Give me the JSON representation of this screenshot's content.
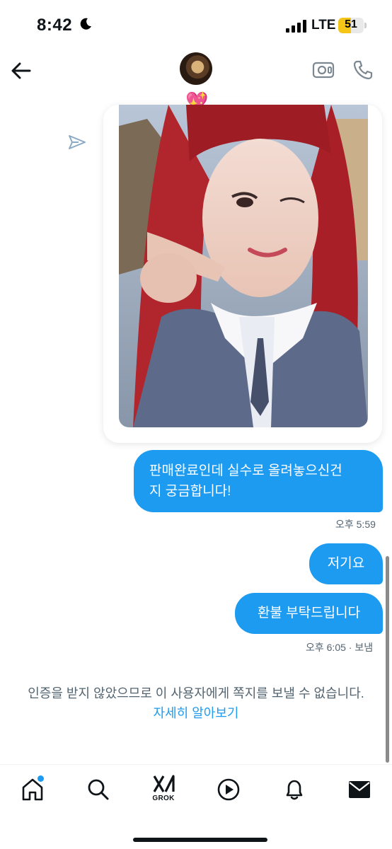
{
  "status_bar": {
    "time": "8:42",
    "network": "LTE",
    "battery": "51",
    "battery_level": 0.51,
    "icons": [
      "moon-icon",
      "signal-icon",
      "battery-icon"
    ]
  },
  "header": {
    "icons": [
      "back-arrow-icon",
      "avatar",
      "sparkling-heart-icon",
      "video-call-icon",
      "phone-icon"
    ],
    "heart_emoji": "💖"
  },
  "conversation": {
    "messages": [
      {
        "text": "판매완료인데 실수로 올려놓으신건지 궁금합니다!",
        "line1": "판매완료인데 실수로 올려놓으신건",
        "line2": "지 궁금합니다!"
      },
      {
        "text": "저기요"
      },
      {
        "text": "환불 부탁드립니다"
      }
    ],
    "timestamp_1": "오후 5:59",
    "timestamp_2": "오후 6:05 · 보냄"
  },
  "notice": {
    "text": "인증을 받지 않았으므로 이 사용자에게 쪽지를 보낼 수 없습니다.",
    "link": "자세히 알아보기"
  },
  "bottom_nav": {
    "grok_label": "GROK",
    "items": [
      "home-icon",
      "search-icon",
      "grok-icon",
      "video-play-icon",
      "bell-icon",
      "mail-icon"
    ]
  },
  "colors": {
    "accent": "#1d9bf0",
    "text_secondary": "#536471",
    "battery": "#f5c518"
  }
}
